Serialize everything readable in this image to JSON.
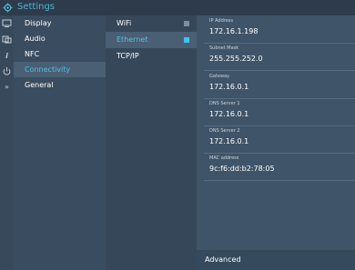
{
  "app": {
    "title": "Settings",
    "accent": "#4fc0e8"
  },
  "rail_icons": [
    "display-icon",
    "nfc-icon",
    "info-icon",
    "power-icon",
    "expand-icon"
  ],
  "menu": {
    "items": [
      {
        "label": "Display"
      },
      {
        "label": "Audio"
      },
      {
        "label": "NFC"
      },
      {
        "label": "Connectivity",
        "selected": true
      },
      {
        "label": "General"
      }
    ]
  },
  "submenu": {
    "items": [
      {
        "label": "WiFi"
      },
      {
        "label": "Ethernet",
        "selected": true
      },
      {
        "label": "TCP/IP"
      }
    ]
  },
  "details": {
    "ip_address": {
      "label": "IP Address",
      "value": "172.16.1.198"
    },
    "subnet_mask": {
      "label": "Subnet Mask",
      "value": "255.255.252.0"
    },
    "gateway": {
      "label": "Gateway",
      "value": "172.16.0.1"
    },
    "dns1": {
      "label": "DNS Server 1",
      "value": "172.16.0.1"
    },
    "dns2": {
      "label": "DNS Server 2",
      "value": "172.16.0.1"
    },
    "mac": {
      "label": "MAC address",
      "value": "9c:f6:dd:b2:78:05"
    }
  },
  "footer": {
    "advanced_label": "Advanced"
  }
}
